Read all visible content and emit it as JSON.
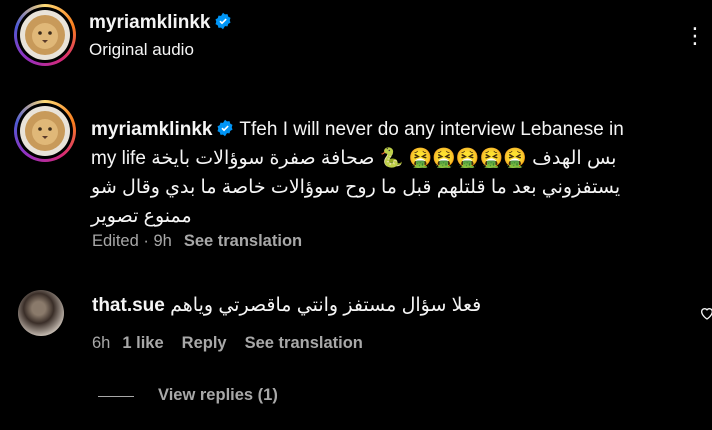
{
  "header": {
    "username": "myriamklinkk",
    "audio_label": "Original audio",
    "more_icon": "more-icon"
  },
  "caption": {
    "username": "myriamklinkk",
    "text_line1": "Tfeh I will never do any interview Lebanese in",
    "text_line2": "my life بس الهدف 🤮🤮🤮🤮🤮 🐍 صحافة صفرة سوؤالات بايخة",
    "text_line3": "يستفزوني بعد ما قلتلهم قبل ما روح سوؤالات خاصة ما بدي وقال شو",
    "text_line4": "ممنوع تصوير",
    "meta_edited": "Edited · 9h",
    "meta_translate": "See translation"
  },
  "comment": {
    "username": "that.sue",
    "text": "فعلا سؤال مستفز وانتي ماقصرتي وياهم",
    "time": "6h",
    "likes": "1 like",
    "reply": "Reply",
    "translate": "See translation",
    "view_replies": "View replies (1)"
  },
  "colors": {
    "background": "#000000",
    "text": "#f5f5f5",
    "muted": "#a8a8a8",
    "verified": "#0095f6"
  }
}
